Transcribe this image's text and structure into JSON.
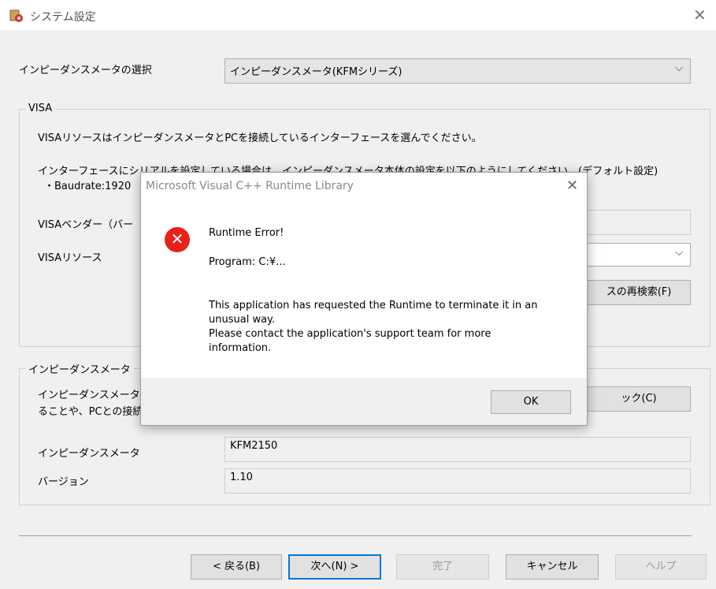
{
  "window": {
    "title": "システム設定",
    "icons": {
      "app": "settings-app-icon",
      "close": "close-icon"
    }
  },
  "meter_select": {
    "label": "インピーダンスメータの選択",
    "value": "インピーダンスメータ(KFMシリーズ)"
  },
  "visa": {
    "group_title": "VISA",
    "desc1": "VISAリソースはインピーダンスメータとPCを接続しているインターフェースを選んでください。",
    "desc2": "インターフェースにシリアルを設定している場合は、インピーダンスメータ本体の設定を以下のようにしてください。(デフォルト設定)",
    "baud": "・Baudrate:1920",
    "vendor_label": "VISAベンダー（バー",
    "resource_label": "VISAリソース",
    "rescan_button": "スの再検索(F)"
  },
  "meter": {
    "group_title": "インピーダンスメータ",
    "desc_line1": "インピーダンスメータと",
    "desc_line2": "ることや、PCとの接続",
    "check_button": "ック(C)",
    "meter_label": "インピーダンスメータ",
    "meter_value": "KFM2150",
    "version_label": "バージョン",
    "version_value": "1.10"
  },
  "buttons": {
    "back": "< 戻る(B)",
    "next": "次へ(N) >",
    "finish": "完了",
    "cancel": "キャンセル",
    "help": "ヘルプ"
  },
  "dialog": {
    "title": "Microsoft Visual C++ Runtime Library",
    "heading": "Runtime Error!",
    "program": "Program: C:¥...",
    "message_line1": "This application has requested the Runtime to terminate it in an",
    "message_line2": "unusual way.",
    "message_line3": "Please contact the application's support team for more",
    "message_line4": "information.",
    "ok": "OK",
    "icons": {
      "error": "error-icon",
      "close": "close-icon"
    }
  }
}
